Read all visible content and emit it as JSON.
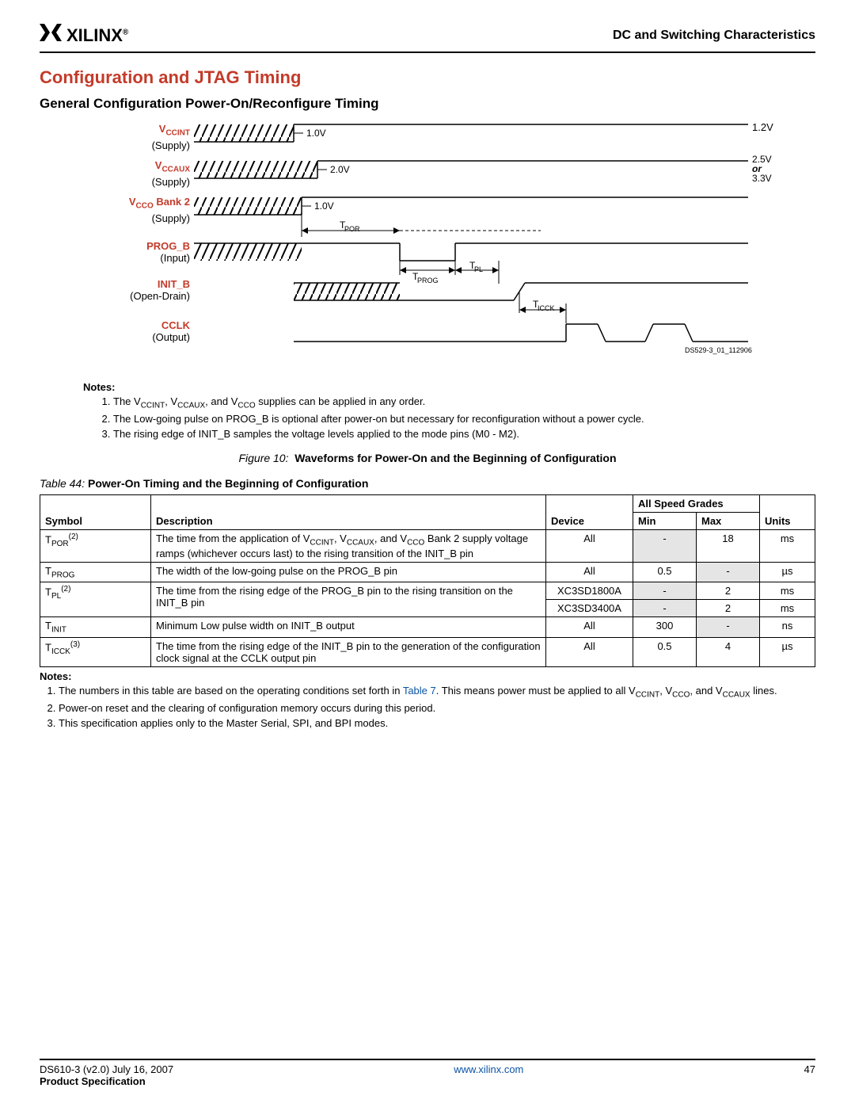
{
  "header": {
    "logo_text": "XILINX",
    "doc_section": "DC and Switching Characteristics"
  },
  "titles": {
    "main": "Configuration and JTAG Timing",
    "sub": "General Configuration Power-On/Reconfigure Timing"
  },
  "diagram": {
    "signals": {
      "vccint": {
        "name": "VCCINT",
        "under": "(Supply)",
        "thresh": "1.0V",
        "final": "1.2V"
      },
      "vccaux": {
        "name": "VCCAUX",
        "under": "(Supply)",
        "thresh": "2.0V",
        "final_a": "2.5V",
        "final_or": "or",
        "final_b": "3.3V"
      },
      "vcco": {
        "name": "VCCO Bank 2",
        "under": "(Supply)",
        "thresh": "1.0V"
      },
      "prog": {
        "name": "PROG_B",
        "under": "(Input)"
      },
      "init": {
        "name": "INIT_B",
        "under": "(Open-Drain)"
      },
      "cclk": {
        "name": "CCLK",
        "under": "(Output)"
      }
    },
    "timing_labels": {
      "tpor": "TPOR",
      "tprog": "TPROG",
      "tpl": "TPL",
      "ticck": "TICCK"
    },
    "ds_ref": "DS529-3_01_112906"
  },
  "figure_notes_header": "Notes:",
  "figure_notes": [
    "The VCCINT, VCCAUX, and VCCO supplies can be applied in any order.",
    "The Low-going pulse on PROG_B is optional after power-on but necessary for reconfiguration without a power cycle.",
    "The rising edge of INIT_B samples the voltage levels applied to the mode pins (M0 - M2)."
  ],
  "figure_caption": {
    "prefix": "Figure 10:",
    "text": "Waveforms for Power-On and the Beginning of Configuration"
  },
  "table_caption": {
    "prefix": "Table  44:",
    "text": "Power-On Timing and the Beginning of Configuration"
  },
  "table_headers": {
    "symbol": "Symbol",
    "description": "Description",
    "device": "Device",
    "span": "All Speed Grades",
    "min": "Min",
    "max": "Max",
    "units": "Units"
  },
  "table_rows": [
    {
      "sym_base": "T",
      "sym_sub": "POR",
      "sym_sup": "(2)",
      "desc": "The time from the application of VCCINT, VCCAUX, and VCCO Bank 2 supply voltage ramps (whichever occurs last) to the rising transition of the INIT_B pin",
      "device": "All",
      "min": "-",
      "max": "18",
      "units": "ms",
      "min_shade": true
    },
    {
      "sym_base": "T",
      "sym_sub": "PROG",
      "sym_sup": "",
      "desc": "The width of the low-going pulse on the PROG_B pin",
      "device": "All",
      "min": "0.5",
      "max": "-",
      "units": "µs",
      "max_shade": true
    },
    {
      "sym_base": "T",
      "sym_sub": "PL",
      "sym_sup": "(2)",
      "rowspan_sym": 2,
      "rowspan_desc": 2,
      "desc": "The time from the rising edge of the PROG_B pin to the rising transition on the INIT_B pin",
      "device": "XC3SD1800A",
      "min": "-",
      "max": "2",
      "units": "ms",
      "min_shade": true
    },
    {
      "device": "XC3SD3400A",
      "min": "-",
      "max": "2",
      "units": "ms",
      "min_shade": true
    },
    {
      "sym_base": "T",
      "sym_sub": "INIT",
      "sym_sup": "",
      "desc": "Minimum Low pulse width on INIT_B output",
      "device": "All",
      "min": "300",
      "max": "-",
      "units": "ns",
      "max_shade": true
    },
    {
      "sym_base": "T",
      "sym_sub": "ICCK",
      "sym_sup": "(3)",
      "desc": "The time from the rising edge of the INIT_B pin to the generation of the configuration clock signal at the CCLK output pin",
      "device": "All",
      "min": "0.5",
      "max": "4",
      "units": "µs"
    }
  ],
  "table_notes_header": "Notes:",
  "table_notes": [
    {
      "pre": "The numbers in this table are based on the operating conditions set forth in ",
      "link": "Table 7",
      "post": ". This means power must be applied to all VCCINT, VCCO, and VCCAUX lines."
    },
    {
      "pre": "Power-on reset and the clearing of configuration memory occurs during this period."
    },
    {
      "pre": "This specification applies only to the Master Serial, SPI, and BPI modes."
    }
  ],
  "footer": {
    "left_line1": "DS610-3 (v2.0) July 16, 2007",
    "left_line2": "Product Specification",
    "center": "www.xilinx.com",
    "right": "47"
  }
}
